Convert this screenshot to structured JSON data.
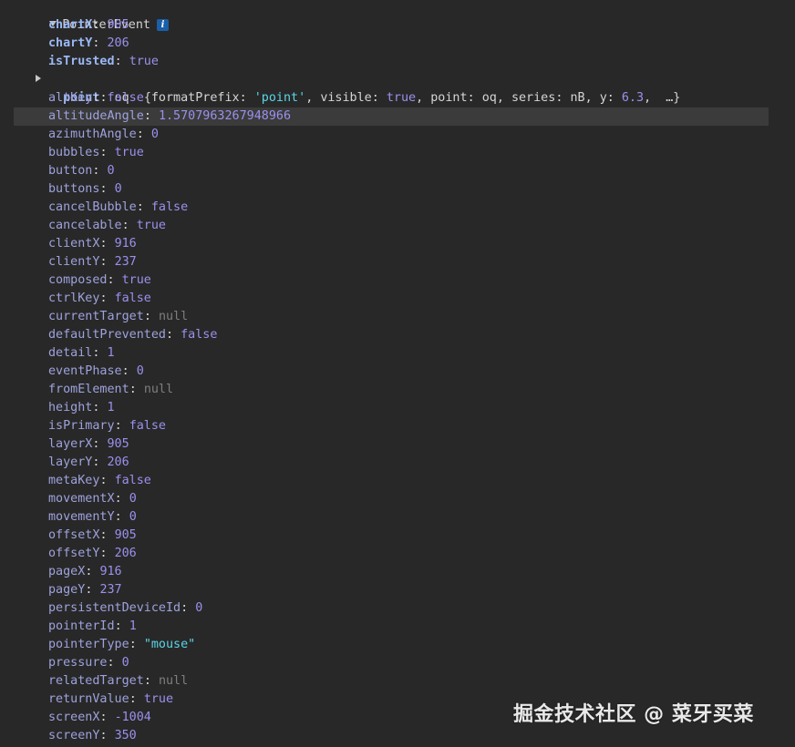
{
  "header": {
    "label": "PointerEvent",
    "info_icon": "i"
  },
  "point_preview": {
    "key": "point",
    "class": "oq",
    "open": "{",
    "formatPrefix_key": "formatPrefix",
    "formatPrefix_val": "'point'",
    "visible_key": "visible",
    "visible_val": "true",
    "point_key": "point",
    "point_val": "oq",
    "series_key": "series",
    "series_val": "nB",
    "y_key": "y",
    "y_val": "6.3",
    "ellipsis": "…}"
  },
  "properties": [
    {
      "key": "chartX",
      "value": "905",
      "type": "num",
      "bold": true
    },
    {
      "key": "chartY",
      "value": "206",
      "type": "num",
      "bold": true
    },
    {
      "key": "isTrusted",
      "value": "true",
      "type": "bool",
      "bold": true
    },
    {
      "key": "__point__",
      "value": "",
      "type": "obj",
      "bold": true
    },
    {
      "key": "altKey",
      "value": "false",
      "type": "bool"
    },
    {
      "key": "altitudeAngle",
      "value": "1.5707963267948966",
      "type": "num"
    },
    {
      "key": "azimuthAngle",
      "value": "0",
      "type": "num"
    },
    {
      "key": "bubbles",
      "value": "true",
      "type": "bool"
    },
    {
      "key": "button",
      "value": "0",
      "type": "num"
    },
    {
      "key": "buttons",
      "value": "0",
      "type": "num"
    },
    {
      "key": "cancelBubble",
      "value": "false",
      "type": "bool"
    },
    {
      "key": "cancelable",
      "value": "true",
      "type": "bool"
    },
    {
      "key": "clientX",
      "value": "916",
      "type": "num"
    },
    {
      "key": "clientY",
      "value": "237",
      "type": "num"
    },
    {
      "key": "composed",
      "value": "true",
      "type": "bool"
    },
    {
      "key": "ctrlKey",
      "value": "false",
      "type": "bool"
    },
    {
      "key": "currentTarget",
      "value": "null",
      "type": "null"
    },
    {
      "key": "defaultPrevented",
      "value": "false",
      "type": "bool"
    },
    {
      "key": "detail",
      "value": "1",
      "type": "num"
    },
    {
      "key": "eventPhase",
      "value": "0",
      "type": "num"
    },
    {
      "key": "fromElement",
      "value": "null",
      "type": "null"
    },
    {
      "key": "height",
      "value": "1",
      "type": "num"
    },
    {
      "key": "isPrimary",
      "value": "false",
      "type": "bool"
    },
    {
      "key": "layerX",
      "value": "905",
      "type": "num"
    },
    {
      "key": "layerY",
      "value": "206",
      "type": "num"
    },
    {
      "key": "metaKey",
      "value": "false",
      "type": "bool"
    },
    {
      "key": "movementX",
      "value": "0",
      "type": "num"
    },
    {
      "key": "movementY",
      "value": "0",
      "type": "num"
    },
    {
      "key": "offsetX",
      "value": "905",
      "type": "num"
    },
    {
      "key": "offsetY",
      "value": "206",
      "type": "num"
    },
    {
      "key": "pageX",
      "value": "916",
      "type": "num"
    },
    {
      "key": "pageY",
      "value": "237",
      "type": "num"
    },
    {
      "key": "persistentDeviceId",
      "value": "0",
      "type": "num"
    },
    {
      "key": "pointerId",
      "value": "1",
      "type": "num"
    },
    {
      "key": "pointerType",
      "value": "\"mouse\"",
      "type": "str"
    },
    {
      "key": "pressure",
      "value": "0",
      "type": "num"
    },
    {
      "key": "relatedTarget",
      "value": "null",
      "type": "null"
    },
    {
      "key": "returnValue",
      "value": "true",
      "type": "bool"
    },
    {
      "key": "screenX",
      "value": "-1004",
      "type": "num"
    },
    {
      "key": "screenY",
      "value": "350",
      "type": "num"
    }
  ],
  "watermark": "掘金技术社区 @ 菜牙买菜",
  "colors": {
    "background": "#282828",
    "key": "#9ea2dd",
    "value_number": "#9a91ee",
    "value_string": "#5ad6e8",
    "value_null": "#7e7e7e",
    "info_badge": "#1a5fa8",
    "row_highlight": "#3b3b3b"
  }
}
